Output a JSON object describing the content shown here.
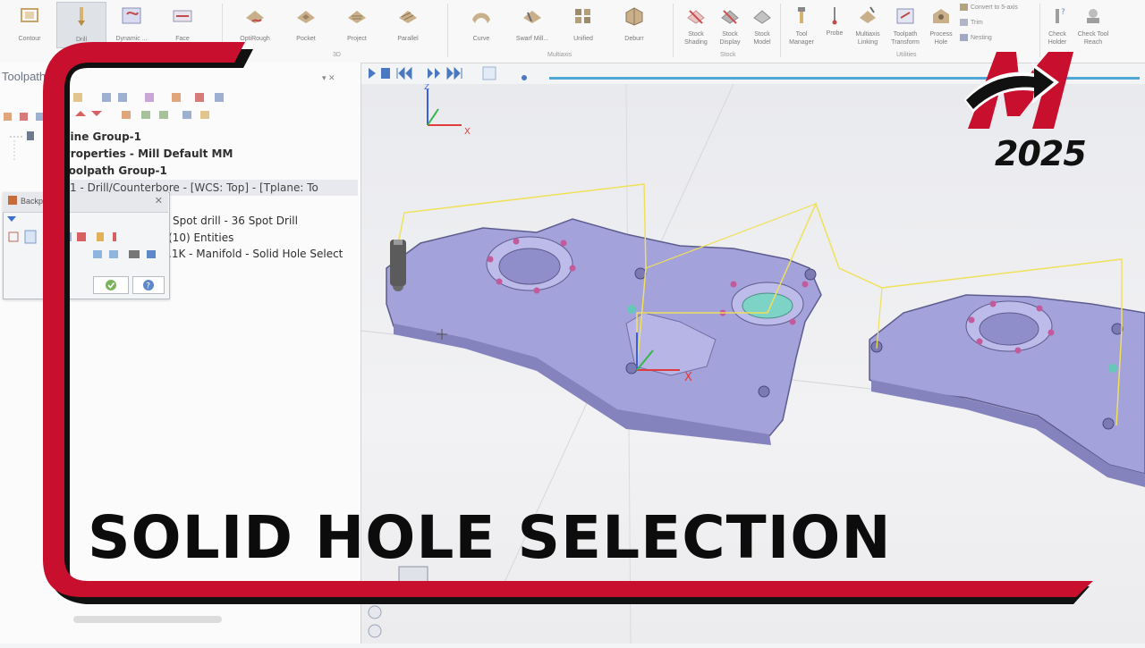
{
  "ribbon": {
    "buttons_2d": [
      {
        "label": "Contour",
        "icon": "contour-icon"
      },
      {
        "label": "Drill",
        "icon": "drill-icon",
        "active": true
      },
      {
        "label": "Dynamic ...",
        "icon": "dynamic-mill-icon"
      },
      {
        "label": "Face",
        "icon": "face-icon"
      }
    ],
    "buttons_3d": [
      {
        "label": "OptiRough",
        "icon": "optirough-icon"
      },
      {
        "label": "Pocket",
        "icon": "pocket-icon"
      },
      {
        "label": "Project",
        "icon": "project-icon"
      },
      {
        "label": "Parallel",
        "icon": "parallel-icon"
      }
    ],
    "group_3d": "3D",
    "buttons_multiaxis": [
      {
        "label": "Curve",
        "icon": "curve-icon"
      },
      {
        "label": "Swarf Mill...",
        "icon": "swarf-icon"
      },
      {
        "label": "Unified",
        "icon": "unified-icon"
      },
      {
        "label": "Deburr",
        "icon": "deburr-icon"
      }
    ],
    "group_multiaxis": "Multiaxis",
    "buttons_stock": [
      {
        "label": "Stock Shading",
        "icon": "stock-shading-icon"
      },
      {
        "label": "Stock Display",
        "icon": "stock-display-icon"
      },
      {
        "label": "Stock Model",
        "icon": "stock-model-icon"
      }
    ],
    "group_stock": "Stock",
    "buttons_utilities": [
      {
        "label": "Tool Manager",
        "icon": "tool-manager-icon"
      },
      {
        "label": "Probe",
        "icon": "probe-icon"
      },
      {
        "label": "Multiaxis Linking",
        "icon": "multiaxis-linking-icon"
      },
      {
        "label": "Toolpath Transform",
        "icon": "toolpath-transform-icon"
      },
      {
        "label": "Process Hole",
        "icon": "process-hole-icon"
      }
    ],
    "small_buttons": [
      "Convert to 5-axis",
      "Trim",
      "Nesting"
    ],
    "group_utilities": "Utilities",
    "buttons_analyze": [
      {
        "label": "Check Holder",
        "icon": "check-holder-icon"
      },
      {
        "label": "Check Tool Reach",
        "icon": "check-tool-reach-icon"
      }
    ]
  },
  "panel": {
    "title": "Toolpath",
    "tree": [
      "hine Group-1",
      "Properties - Mill Default MM",
      "Toolpath Group-1",
      "1 - Drill/Counterbore - [WCS: Top] - [Tplane: To",
      "Spot drill - 36 Spot Drill",
      "(10) Entities",
      ".1K - Manifold - Solid Hole Select"
    ]
  },
  "dialog": {
    "title": "Backp"
  },
  "viewport": {
    "axis_x": "X",
    "axis_y": "Y",
    "axis_z": "Z"
  },
  "overlay": {
    "banner": "SOLID HOLE SELECTION",
    "logo_year": "2025",
    "brand_color": "#c8102e"
  }
}
